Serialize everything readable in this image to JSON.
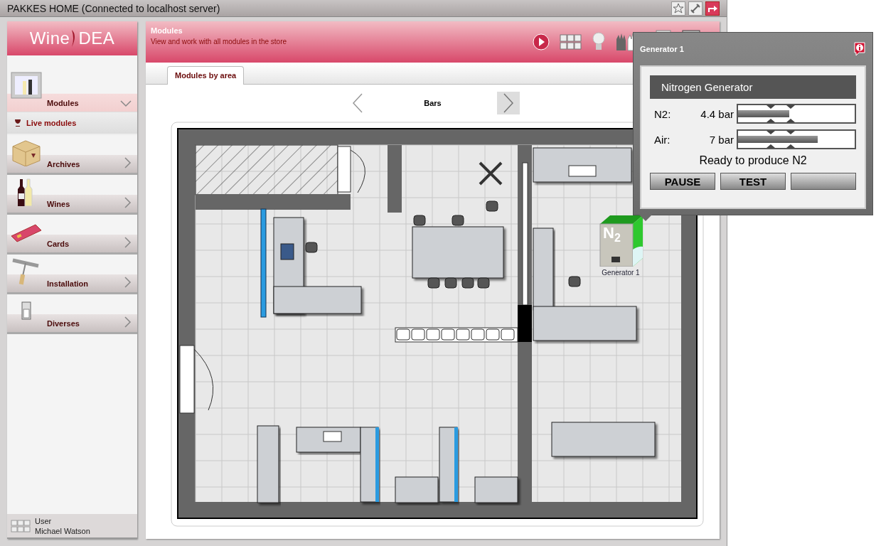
{
  "window": {
    "title": "PAKKES HOME (Connected to localhost server)"
  },
  "sidebar": {
    "logo": {
      "left": "Wine",
      "right": "DEA"
    },
    "items": [
      {
        "label": "Modules",
        "expanded": true,
        "children": [
          {
            "label": "Live modules",
            "selected": true
          }
        ]
      },
      {
        "label": "Archives",
        "expanded": false
      },
      {
        "label": "Wines",
        "expanded": false
      },
      {
        "label": "Cards",
        "expanded": false
      },
      {
        "label": "Installation",
        "expanded": false
      },
      {
        "label": "Diverses",
        "expanded": false
      }
    ],
    "user": {
      "caption": "User",
      "name": "Michael Watson"
    }
  },
  "header": {
    "title": "Modules",
    "subtitle": "View and work with all modules in the store"
  },
  "tabs": [
    {
      "label": "Modules by area",
      "selected": true
    }
  ],
  "area": {
    "name": "Bars"
  },
  "generator": {
    "label": "Generator 1",
    "mark": "N$_{2}$"
  },
  "popup": {
    "title": "Generator 1",
    "heading": "Nitrogen Generator",
    "readings": [
      {
        "name": "N2:",
        "value": "4.4 bar",
        "level": 0.44
      },
      {
        "name": "Air:",
        "value": "7 bar",
        "level": 0.68
      }
    ],
    "status": "Ready to produce N2",
    "buttons": [
      "PAUSE",
      "TEST"
    ]
  }
}
